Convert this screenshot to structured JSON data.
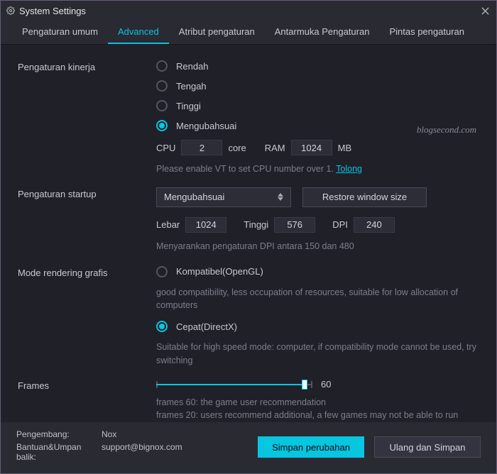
{
  "window": {
    "title": "System Settings"
  },
  "tabs": [
    "Pengaturan umum",
    "Advanced",
    "Atribut pengaturan",
    "Antarmuka Pengaturan",
    "Pintas pengaturan"
  ],
  "active_tab": 1,
  "perf": {
    "label": "Pengaturan kinerja",
    "options": [
      "Rendah",
      "Tengah",
      "Tinggi",
      "Mengubahsuai"
    ],
    "selected": 3,
    "cpu_label": "CPU",
    "cpu_value": "2",
    "cpu_unit": "core",
    "ram_label": "RAM",
    "ram_value": "1024",
    "ram_unit": "MB",
    "hint_pre": "Please enable VT to set CPU number over 1. ",
    "hint_link": "Tolong"
  },
  "startup": {
    "label": "Pengaturan startup",
    "select_value": "Mengubahsuai",
    "restore_btn": "Restore window size",
    "lebar_label": "Lebar",
    "lebar_value": "1024",
    "tinggi_label": "Tinggi",
    "tinggi_value": "576",
    "dpi_label": "DPI",
    "dpi_value": "240",
    "hint": "Menyarankan pengaturan DPI antara 150 dan 480"
  },
  "render": {
    "label": "Mode rendering grafis",
    "options": [
      "Kompatibel(OpenGL)",
      "Cepat(DirectX)"
    ],
    "selected": 1,
    "hint0": "good compatibility, less occupation of resources, suitable for low allocation of computers",
    "hint1": "Suitable for high speed mode: computer, if compatibility mode cannot be used, try switching"
  },
  "frames": {
    "label": "Frames",
    "value": "60",
    "max": 60,
    "percent": 95,
    "hint1": "frames 60: the game user recommendation",
    "hint2": "frames 20: users recommend additional, a few games may not be able to run"
  },
  "footer": {
    "dev_label": "Pengembang:",
    "dev_value": "Nox",
    "help_label": "Bantuan&Umpan balik:",
    "help_value": "support@bignox.com",
    "save": "Simpan perubahan",
    "reset": "Ulang dan Simpan"
  },
  "watermark": "blogsecond.com"
}
